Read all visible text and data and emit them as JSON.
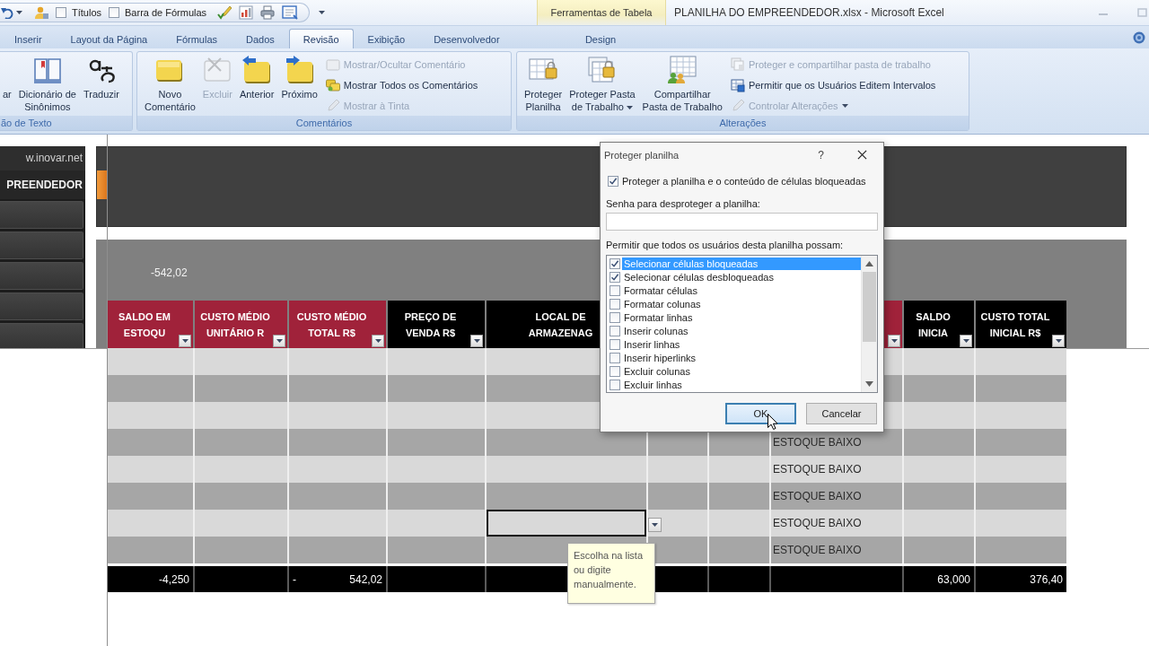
{
  "quick_access": {
    "items": [
      {
        "label": "Títulos",
        "checked": false
      },
      {
        "label": "Barra de Fórmulas",
        "checked": false
      }
    ]
  },
  "title_bar": {
    "context_header": "Ferramentas de Tabela",
    "title": "PLANILHA DO EMPREENDEDOR.xlsx - Microsoft Excel"
  },
  "ribbon_tabs": [
    {
      "label": "Inserir",
      "selected": false
    },
    {
      "label": "Layout da Página",
      "selected": false
    },
    {
      "label": "Fórmulas",
      "selected": false
    },
    {
      "label": "Dados",
      "selected": false
    },
    {
      "label": "Revisão",
      "selected": true
    },
    {
      "label": "Exibição",
      "selected": false
    },
    {
      "label": "Desenvolvedor",
      "selected": false
    }
  ],
  "context_tabs": [
    {
      "label": "Design",
      "selected": false
    }
  ],
  "ribbon": {
    "proofing": {
      "label": "ão de Texto",
      "research": {
        "lines": [
          "ar"
        ],
        "disabled": false
      },
      "thesaurus": {
        "lines": [
          "Dicionário de",
          "Sinônimos"
        ],
        "disabled": false
      },
      "translate": {
        "lines": [
          "Traduzir"
        ],
        "disabled": false
      }
    },
    "comments": {
      "label": "Comentários",
      "new_comment": {
        "lines": [
          "Novo",
          "Comentário"
        ],
        "disabled": false
      },
      "delete": {
        "lines": [
          "Excluir"
        ],
        "disabled": true
      },
      "previous": {
        "lines": [
          "Anterior"
        ],
        "disabled": false
      },
      "next": {
        "lines": [
          "Próximo"
        ],
        "disabled": false
      },
      "show_hide": {
        "label": "Mostrar/Ocultar Comentário",
        "disabled": true
      },
      "show_all": {
        "label": "Mostrar Todos os Comentários",
        "disabled": false
      },
      "show_ink": {
        "label": "Mostrar à Tinta",
        "disabled": true
      }
    },
    "changes": {
      "label": "Alterações",
      "protect_sheet": {
        "lines": [
          "Proteger",
          "Planilha"
        ],
        "disabled": false
      },
      "protect_workbook": {
        "lines": [
          "Proteger Pasta",
          "de Trabalho"
        ],
        "disabled": false,
        "menu": true
      },
      "share_workbook": {
        "lines": [
          "Compartilhar",
          "Pasta de Trabalho"
        ],
        "disabled": false
      },
      "protect_share": {
        "label": "Proteger e compartilhar pasta de trabalho",
        "disabled": true
      },
      "allow_edit_ranges": {
        "label": "Permitir que os Usuários Editem Intervalos",
        "disabled": false
      },
      "track_changes": {
        "label": "Controlar Alterações",
        "disabled": true,
        "menu": true
      }
    }
  },
  "sidebar": {
    "link": "w.inovar.net",
    "title": "PREENDEDOR"
  },
  "table": {
    "summary": "-542,02",
    "columns": [
      {
        "header": "SALDO EM ESTOQU",
        "color": "#a0223a",
        "filter": true
      },
      {
        "header": "CUSTO MÉDIO UNITÁRIO R",
        "color": "#a0223a",
        "filter": true
      },
      {
        "header": "CUSTO MÉDIO TOTAL R$",
        "color": "#a0223a",
        "filter": true
      },
      {
        "header": "PREÇO DE VENDA R$",
        "color": "#000000",
        "filter": true
      },
      {
        "header": "LOCAL DE ARMAZENAG",
        "color": "#000000"
      },
      null,
      null,
      {
        "color": "#a0223a",
        "filter": true
      },
      {
        "header": "SALDO INICIA",
        "color": "#000000",
        "filter": true
      },
      {
        "header": "CUSTO TOTAL INICIAL R$",
        "color": "#000000",
        "filter": true
      }
    ],
    "rows": [
      {
        "cells": [
          {
            "selected": false
          },
          {
            "selected": false
          },
          {
            "selected": false
          },
          {
            "selected": false
          },
          {
            "selected": false
          },
          null,
          null,
          {
            "selected": false
          },
          {
            "selected": false
          },
          {
            "selected": false
          }
        ]
      },
      {
        "cells": [
          {
            "selected": false
          },
          {
            "selected": false
          },
          {
            "selected": false
          },
          {
            "selected": false
          },
          {
            "selected": false
          },
          null,
          null,
          {
            "selected": false
          },
          {
            "selected": false
          },
          {
            "selected": false
          }
        ]
      },
      {
        "cells": [
          {
            "selected": false
          },
          {
            "selected": false
          },
          {
            "selected": false
          },
          {
            "selected": false
          },
          {
            "selected": false
          },
          null,
          null,
          {
            "selected": false
          },
          {
            "selected": false
          },
          {
            "selected": false
          }
        ]
      },
      {
        "cells": [
          {
            "selected": false
          },
          {
            "selected": false
          },
          {
            "selected": false
          },
          {
            "selected": false
          },
          {
            "selected": false
          },
          {
            "selected": false
          },
          {
            "selected": false
          },
          {
            "text": "ESTOQUE BAIXO",
            "selected": false
          },
          {
            "selected": false
          },
          {
            "selected": false
          }
        ]
      },
      {
        "cells": [
          {
            "selected": false
          },
          {
            "selected": false
          },
          {
            "selected": false
          },
          {
            "selected": false
          },
          {
            "selected": false
          },
          {
            "selected": false
          },
          {
            "selected": false
          },
          {
            "text": "ESTOQUE BAIXO",
            "selected": false
          },
          {
            "selected": false
          },
          {
            "selected": false
          }
        ]
      },
      {
        "cells": [
          {
            "selected": false
          },
          {
            "selected": false
          },
          {
            "selected": false
          },
          {
            "selected": false
          },
          {
            "selected": false
          },
          {
            "selected": false
          },
          {
            "selected": false
          },
          {
            "text": "ESTOQUE BAIXO",
            "selected": false
          },
          {
            "selected": false
          },
          {
            "selected": false
          }
        ]
      },
      {
        "cells": [
          {
            "selected": false
          },
          {
            "selected": false
          },
          {
            "selected": false
          },
          {
            "selected": false
          },
          {
            "selected": true,
            "dropdown": true
          },
          {
            "selected": false
          },
          {
            "selected": false
          },
          {
            "text": "ESTOQUE BAIXO",
            "selected": false
          },
          {
            "selected": false
          },
          {
            "selected": false
          }
        ]
      },
      {
        "cells": [
          {
            "selected": false
          },
          {
            "selected": false
          },
          {
            "selected": false
          },
          {
            "selected": false
          },
          {
            "selected": false
          },
          {
            "selected": false
          },
          {
            "selected": false
          },
          {
            "text": "ESTOQUE BAIXO",
            "selected": false
          },
          {
            "selected": false
          },
          {
            "selected": false
          }
        ]
      }
    ],
    "totals": [
      {
        "text": "-4,250",
        "selected": false
      },
      {
        "selected": false
      },
      {
        "prefix": "-",
        "text": "542,02",
        "selected": false
      },
      {
        "selected": false
      },
      {
        "selected": false
      },
      {
        "selected": false
      },
      {
        "selected": false
      },
      {
        "selected": false
      },
      {
        "text": "63,000",
        "selected": false
      },
      {
        "text": "376,40",
        "selected": false
      }
    ],
    "input_message": "Escolha na lista ou digite manualmente."
  },
  "dialog": {
    "title": "Proteger planilha",
    "help": "?",
    "protect": {
      "label": "Proteger a planilha e o conteúdo de células bloqueadas",
      "checked": true
    },
    "password": {
      "label": "Senha para desproteger a planilha:"
    },
    "permissions_label": "Permitir que todos os usuários desta planilha possam:",
    "permissions": [
      {
        "label": "Selecionar células bloqueadas",
        "checked": true,
        "selected": true
      },
      {
        "label": "Selecionar células desbloqueadas",
        "checked": true,
        "selected": false
      },
      {
        "label": "Formatar células",
        "checked": false,
        "selected": false
      },
      {
        "label": "Formatar colunas",
        "checked": false,
        "selected": false
      },
      {
        "label": "Formatar linhas",
        "checked": false,
        "selected": false
      },
      {
        "label": "Inserir colunas",
        "checked": false,
        "selected": false
      },
      {
        "label": "Inserir linhas",
        "checked": false,
        "selected": false
      },
      {
        "label": "Inserir hiperlinks",
        "checked": false,
        "selected": false
      },
      {
        "label": "Excluir colunas",
        "checked": false,
        "selected": false
      },
      {
        "label": "Excluir linhas",
        "checked": false,
        "selected": false
      }
    ],
    "buttons": [
      {
        "label": "OK",
        "default": true
      },
      {
        "label": "Cancelar",
        "default": false
      }
    ]
  }
}
